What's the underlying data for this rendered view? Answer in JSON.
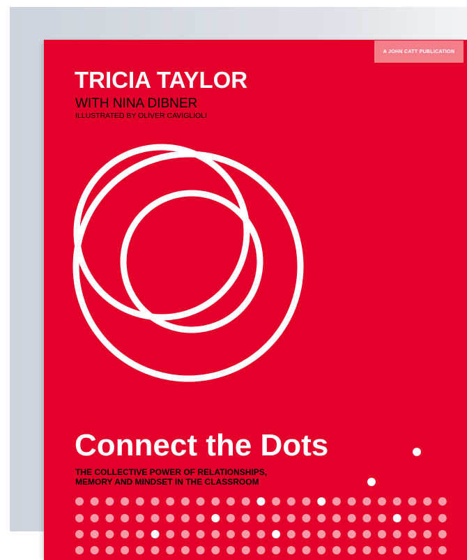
{
  "cover": {
    "publisher": "A JOHN CATT PUBLICATION",
    "author": "TRICIA TAYLOR",
    "coauthor": "WITH NINA DIBNER",
    "illustrator": "ILLUSTRATED BY OLIVER CAVIGLIOLI",
    "title": "Connect the Dots",
    "subtitle_line1": "THE COLLECTIVE POWER OF RELATIONSHIPS,",
    "subtitle_line2": "MEMORY AND MINDSET IN THE CLASSROOM"
  },
  "colors": {
    "cover_red": "#e4002b",
    "dot_pink": "#f59aa6",
    "dot_white": "#ffffff",
    "tag_pink": "#f47e8a"
  },
  "icons": [
    "overlapping-circles-logo",
    "dot-pattern"
  ]
}
